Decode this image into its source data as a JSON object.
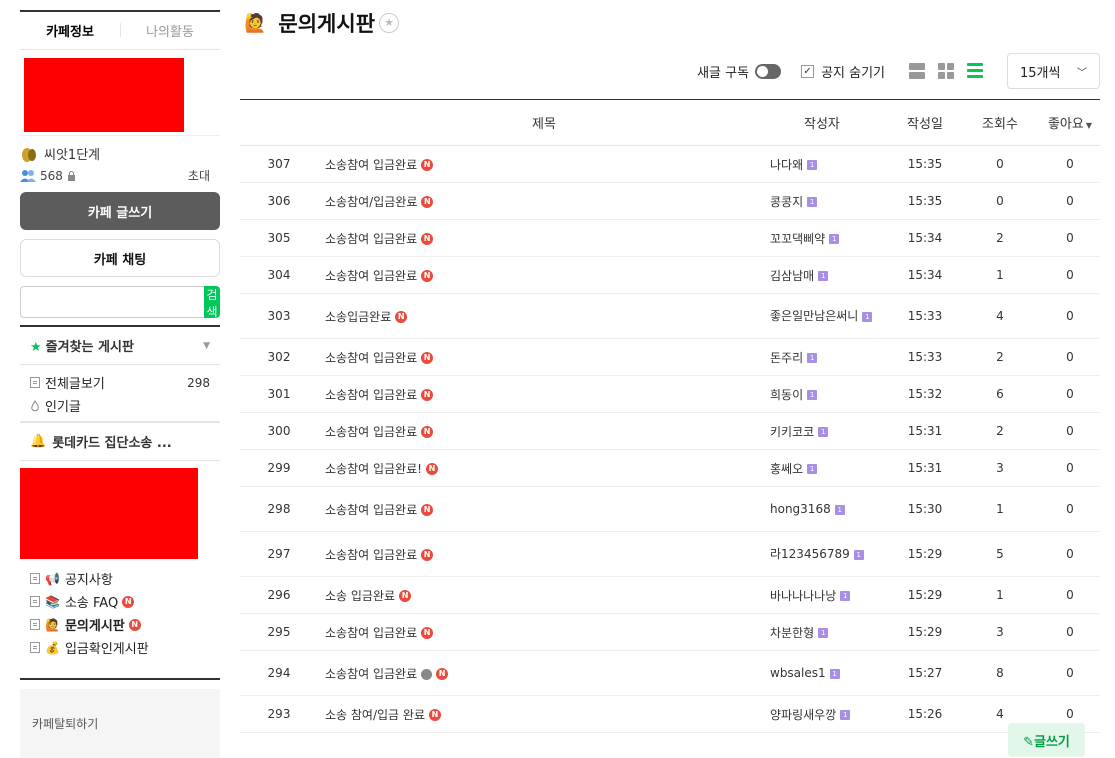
{
  "sidebar": {
    "tabs": [
      {
        "label": "카페정보"
      },
      {
        "label": "나의활동"
      }
    ],
    "grade": "씨앗1단계",
    "member_count": "568",
    "invite": "초대",
    "write_button": "카페 글쓰기",
    "chat_button": "카페 채팅",
    "search_button": "검색",
    "search_value": "",
    "favorites_title": "즐겨찾는 게시판",
    "menu": [
      {
        "label": "전체글보기",
        "count": "298"
      },
      {
        "label": "인기글"
      }
    ],
    "cafe_name": "롯데카드 집단소송 ...",
    "boards": [
      {
        "label": "공지사항"
      },
      {
        "label": "소송 FAQ",
        "new": "N"
      },
      {
        "label": "문의게시판",
        "new": "N"
      },
      {
        "label": "입금확인게시판"
      }
    ],
    "leave": "카페탈퇴하기"
  },
  "main": {
    "title": "문의게시판",
    "subscribe_label": "새글 구독",
    "hide_notice_label": "공지 숨기기",
    "hide_notice_checked": true,
    "per_page": "15개씩",
    "write_button": "글쓰기",
    "columns": {
      "title": "제목",
      "author": "작성자",
      "date": "작성일",
      "views": "조회수",
      "likes": "좋아요"
    },
    "rows": [
      {
        "no": "307",
        "title": "소송참여 입금완료",
        "author": "나다왜",
        "date": "15:35",
        "views": "0",
        "likes": "0"
      },
      {
        "no": "306",
        "title": "소송참여/입금완료",
        "author": "콩콩지",
        "date": "15:35",
        "views": "0",
        "likes": "0"
      },
      {
        "no": "305",
        "title": "소송참여 입금완료",
        "author": "꼬꼬댁삐약",
        "date": "15:34",
        "views": "2",
        "likes": "0"
      },
      {
        "no": "304",
        "title": "소송참여 입금완료",
        "author": "김삼남매",
        "date": "15:34",
        "views": "1",
        "likes": "0"
      },
      {
        "no": "303",
        "title": "소송입금완료",
        "author": "좋은일만남은써니",
        "date": "15:33",
        "views": "4",
        "likes": "0"
      },
      {
        "no": "302",
        "title": "소송참여 입금완료",
        "author": "돈주리",
        "date": "15:33",
        "views": "2",
        "likes": "0"
      },
      {
        "no": "301",
        "title": "소송참여 입금완료",
        "author": "희동이",
        "date": "15:32",
        "views": "6",
        "likes": "0"
      },
      {
        "no": "300",
        "title": "소송참여 입금완료",
        "author": "키키코코",
        "date": "15:31",
        "views": "2",
        "likes": "0"
      },
      {
        "no": "299",
        "title": "소송참여 입금완료!",
        "author": "홍쎄오",
        "date": "15:31",
        "views": "3",
        "likes": "0"
      },
      {
        "no": "298",
        "title": "소송참여 입금완료",
        "author": "hong3168",
        "date": "15:30",
        "views": "1",
        "likes": "0"
      },
      {
        "no": "297",
        "title": "소송참여 입금완료",
        "author": "라123456789",
        "date": "15:29",
        "views": "5",
        "likes": "0"
      },
      {
        "no": "296",
        "title": "소송 입금완료",
        "author": "바나나나나낭",
        "date": "15:29",
        "views": "1",
        "likes": "0"
      },
      {
        "no": "295",
        "title": "소송참여 입금완료",
        "author": "차분한형",
        "date": "15:29",
        "views": "3",
        "likes": "0"
      },
      {
        "no": "294",
        "title": "소송참여 입금완료",
        "author": "wbsales1",
        "date": "15:27",
        "views": "8",
        "likes": "0"
      },
      {
        "no": "293",
        "title": "소송 참여/입금 완료",
        "author": "양파링새우깡",
        "date": "15:26",
        "views": "4",
        "likes": "0"
      }
    ],
    "new_badge": "N",
    "level_badge": "1"
  },
  "colors": {
    "accent_green": "#03c75a",
    "new_badge_red": "#e74c3c",
    "level_purple": "#a98ee6",
    "redaction": "#ff0000"
  }
}
